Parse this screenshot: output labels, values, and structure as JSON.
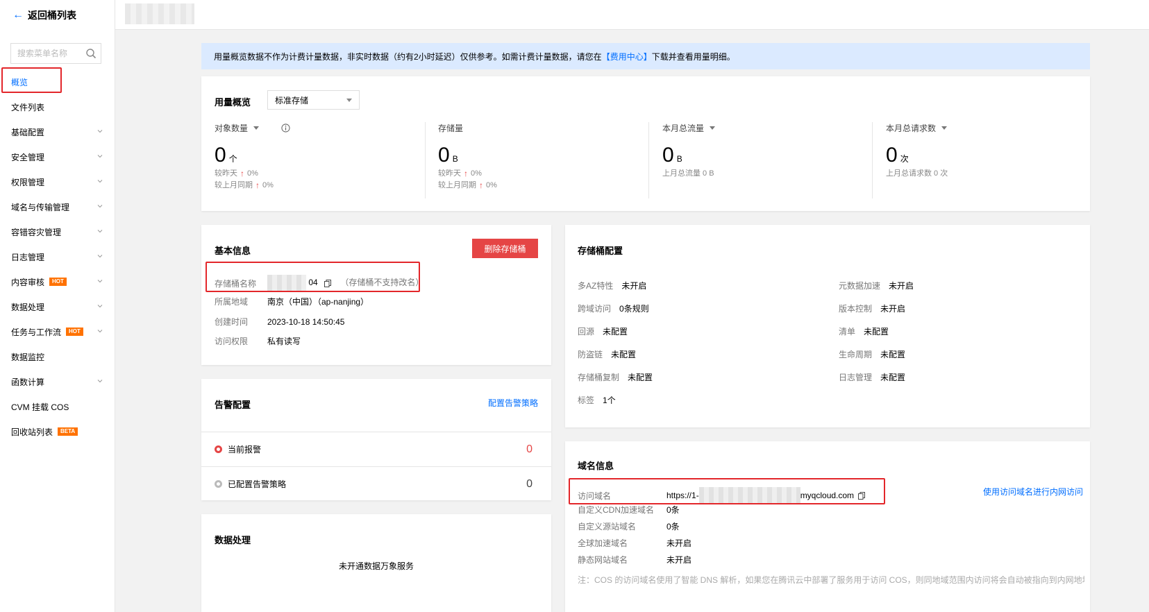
{
  "sidebar": {
    "back_label": "返回桶列表",
    "search_placeholder": "搜索菜单名称",
    "items": [
      {
        "label": "概览",
        "active": true,
        "chevron": false
      },
      {
        "label": "文件列表",
        "chevron": false
      },
      {
        "label": "基础配置",
        "chevron": true
      },
      {
        "label": "安全管理",
        "chevron": true
      },
      {
        "label": "权限管理",
        "chevron": true
      },
      {
        "label": "域名与传输管理",
        "chevron": true
      },
      {
        "label": "容错容灾管理",
        "chevron": true
      },
      {
        "label": "日志管理",
        "chevron": true
      },
      {
        "label": "内容审核",
        "badge": "HOT",
        "chevron": true
      },
      {
        "label": "数据处理",
        "chevron": true
      },
      {
        "label": "任务与工作流",
        "badge": "HOT",
        "chevron": true
      },
      {
        "label": "数据监控",
        "chevron": false
      },
      {
        "label": "函数计算",
        "chevron": true
      },
      {
        "label": "CVM 挂载 COS",
        "chevron": false
      },
      {
        "label": "回收站列表",
        "badge": "BETA",
        "chevron": false
      }
    ]
  },
  "notice": {
    "text_before": "用量概览数据不作为计费计量数据，非实时数据（约有2小时延迟）仅供参考。如需计费计量数据，请您在",
    "link": "【费用中心】",
    "text_after": "下载并查看用量明细。"
  },
  "usage": {
    "title": "用量概览",
    "storage_class": "标准存储",
    "metrics": [
      {
        "label": "对象数量",
        "value": "0",
        "unit": "个",
        "sub1_label": "较昨天",
        "sub1_value": "0%",
        "sub2_label": "较上月同期",
        "sub2_value": "0%"
      },
      {
        "label": "存储量",
        "value": "0",
        "unit": "B",
        "sub1_label": "较昨天",
        "sub1_value": "0%",
        "sub2_label": "较上月同期",
        "sub2_value": "0%"
      },
      {
        "label": "本月总流量",
        "value": "0",
        "unit": "B",
        "sub1_label": "上月总流量 0 B"
      },
      {
        "label": "本月总请求数",
        "value": "0",
        "unit": "次",
        "sub1_label": "上月总请求数 0 次"
      }
    ]
  },
  "basic": {
    "title": "基本信息",
    "delete_label": "删除存储桶",
    "name_label": "存储桶名称",
    "name_suffix": "04",
    "name_note": "（存储桶不支持改名）",
    "region_label": "所属地域",
    "region_value": "南京（中国）（ap-nanjing）",
    "created_label": "创建时间",
    "created_value": "2023-10-18 14:50:45",
    "access_label": "访问权限",
    "access_value": "私有读写"
  },
  "alarm": {
    "title": "告警配置",
    "link": "配置告警策略",
    "current_label": "当前报警",
    "current_count": "0",
    "configured_label": "已配置告警策略",
    "configured_count": "0"
  },
  "dproc": {
    "title": "数据处理",
    "message": "未开通数据万象服务"
  },
  "bucket_config": {
    "title": "存储桶配置",
    "left": [
      {
        "k": "多AZ特性",
        "v": "未开启"
      },
      {
        "k": "跨域访问",
        "v": "0条规则"
      },
      {
        "k": "回源",
        "v": "未配置"
      },
      {
        "k": "防盗链",
        "v": "未配置"
      },
      {
        "k": "存储桶复制",
        "v": "未配置"
      },
      {
        "k": "标签",
        "v": "1个"
      }
    ],
    "right": [
      {
        "k": "元数据加速",
        "v": "未开启"
      },
      {
        "k": "版本控制",
        "v": "未开启"
      },
      {
        "k": "清单",
        "v": "未配置"
      },
      {
        "k": "生命周期",
        "v": "未配置"
      },
      {
        "k": "日志管理",
        "v": "未配置"
      }
    ]
  },
  "domain": {
    "title": "域名信息",
    "link": "使用访问域名进行内网访问",
    "access_label": "访问域名",
    "access_prefix": "https://1-",
    "access_suffix": "myqcloud.com",
    "rows": [
      {
        "k": "自定义CDN加速域名",
        "v": "0条"
      },
      {
        "k": "自定义源站域名",
        "v": "0条"
      },
      {
        "k": "全球加速域名",
        "v": "未开启"
      },
      {
        "k": "静态网站域名",
        "v": "未开启"
      }
    ],
    "footnote": "注：COS 的访问域名使用了智能 DNS 解析，如果您在腾讯云中部署了服务用于访问 COS，则同地域范围内访问将会自动被指向到内网地址。跨"
  },
  "colors": {
    "accent": "#006eff",
    "danger": "#e54545",
    "highlight": "#e3262a",
    "notice_bg": "#dbeaff"
  }
}
